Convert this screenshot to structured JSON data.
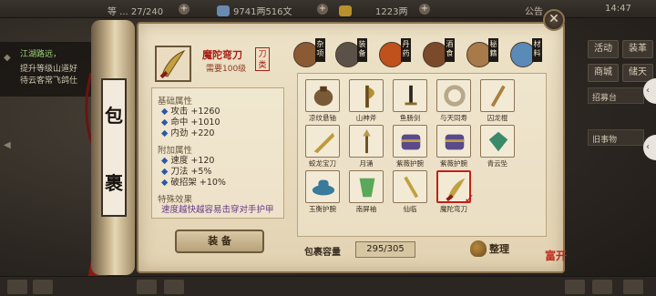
{
  "top_bar": {
    "level_text": "等 ... 27/240",
    "currency1": "9741两516文",
    "currency2": "1223两",
    "notice": "公告",
    "time": "14:47"
  },
  "left_panel": {
    "quest_title": "江湖路远，",
    "quest_line1": "提升等级山道好",
    "quest_line2": "待云客常飞鸽仕"
  },
  "right_panel": {
    "buttons": [
      "活动",
      "装革",
      "商城",
      "储天",
      "招募台"
    ],
    "item_label": "招募台",
    "chat_label": "旧事物"
  },
  "scroll_label": [
    "包",
    "裹"
  ],
  "selected_item": {
    "name": "魔陀弯刀",
    "requirement": "需要100级",
    "type": "刀类",
    "base_attr_title": "基础属性",
    "base_attrs": [
      {
        "k": "攻击",
        "v": "+1260"
      },
      {
        "k": "命中",
        "v": "+1010"
      },
      {
        "k": "内劲",
        "v": "+220"
      }
    ],
    "extra_attr_title": "附加属性",
    "extra_attrs": [
      {
        "k": "速度",
        "v": "+120"
      },
      {
        "k": "刀法",
        "v": "+5%"
      },
      {
        "k": "破招架",
        "v": "+10%"
      }
    ],
    "special_title": "特殊效果",
    "special_desc": "速度越快越容易击穿对手护甲"
  },
  "equip_button": "装 备",
  "categories": [
    {
      "label": "杂项",
      "color": "#8a5a34"
    },
    {
      "label": "装备",
      "color": "#5a5248"
    },
    {
      "label": "丹药",
      "color": "#c0501c"
    },
    {
      "label": "酒食",
      "color": "#7a4a2a"
    },
    {
      "label": "秘籍",
      "color": "#a87a4a"
    },
    {
      "label": "材料",
      "color": "#5a8ab8"
    }
  ],
  "items": [
    {
      "label": "凉纹悬铀",
      "color": "#7a5a36",
      "shape": "pouch"
    },
    {
      "label": "山神斧",
      "color": "#b8902c",
      "shape": "axe"
    },
    {
      "label": "鱼肠剑",
      "color": "#2a2520",
      "shape": "sword"
    },
    {
      "label": "与天同寿",
      "color": "#b8a88a",
      "shape": "ring"
    },
    {
      "label": "囚龙棍",
      "color": "#a8803c",
      "shape": "staff"
    },
    {
      "label": "蛟龙宝刀",
      "color": "#c09a3a",
      "shape": "blade"
    },
    {
      "label": "月涌",
      "color": "#b89a52",
      "shape": "spear"
    },
    {
      "label": "紫薇护腕",
      "color": "#5a4a8a",
      "shape": "armor"
    },
    {
      "label": "紫薇护腕",
      "color": "#5a4a8a",
      "shape": "armor"
    },
    {
      "label": "青云坠",
      "color": "#3a8a6a",
      "shape": "jade"
    },
    {
      "label": "玉衡护腕",
      "color": "#3a7a9a",
      "shape": "hat"
    },
    {
      "label": "南屏袖",
      "color": "#5aa85a",
      "shape": "cloth"
    },
    {
      "label": "仙临",
      "color": "#c0a040",
      "shape": "sword2"
    },
    {
      "label": "魔陀弯刀",
      "color": "#c0a040",
      "shape": "curved",
      "selected": true
    }
  ],
  "capacity_label": "包裹容量",
  "capacity_value": "295/305",
  "sort_label": "整理",
  "seal_text": "富开"
}
